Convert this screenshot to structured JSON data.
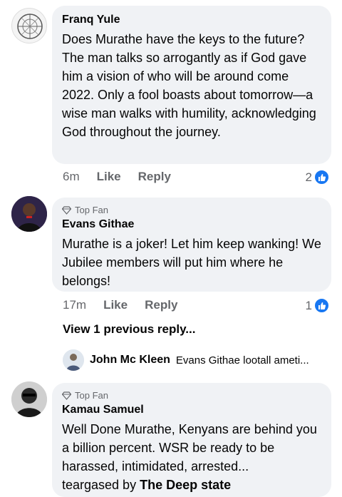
{
  "comments": [
    {
      "author": "Franq Yule",
      "text": "Does Murathe have the keys to the future? The man talks so arrogantly as if God gave him a vision of who will be around come 2022. Only a fool boasts about tomorrow—a wise man walks with humility, acknowledging God throughout the journey.",
      "time": "6m",
      "like_label": "Like",
      "reply_label": "Reply",
      "reaction_count": "2"
    },
    {
      "badge": "Top Fan",
      "author": "Evans Githae",
      "text": "Murathe is a joker! Let him keep wanking! We Jubilee members will put him where he belongs!",
      "time": "17m",
      "like_label": "Like",
      "reply_label": "Reply",
      "reaction_count": "1"
    },
    {
      "badge": "Top Fan",
      "author": "Kamau Samuel",
      "text": "Well Done Murathe, Kenyans are behind you a billion percent. WSR be ready to be harassed, intimidated, arrested...",
      "tail_prefix": "teargased by ",
      "tail_bold": "The Deep state"
    }
  ],
  "replies": {
    "view_previous_label": "View 1 previous reply...",
    "preview_author": "John Mc Kleen",
    "preview_snippet": "Evans Githae lootall ameti..."
  },
  "colors": {
    "bubble": "#f0f2f5",
    "meta": "#65676b",
    "like_blue": "#1877f2"
  }
}
